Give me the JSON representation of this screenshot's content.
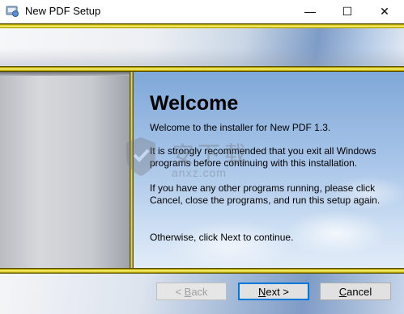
{
  "window": {
    "title": "New PDF Setup",
    "controls": {
      "minimize": "—",
      "maximize": "☐",
      "close": "✕"
    }
  },
  "welcome": {
    "heading": "Welcome",
    "paragraphs": [
      "Welcome to the installer for New PDF 1.3.",
      "It is strongly recommended that you exit all Windows programs before continuing with this installation.",
      "If you have any other programs running, please click Cancel, close the programs, and run this setup again.",
      "Otherwise, click Next to continue."
    ]
  },
  "watermark": {
    "text_cn": "安下载",
    "text_en": "anxz.com"
  },
  "buttons": {
    "back": {
      "mnemonic": "B",
      "rest": "ack",
      "prefix": "< ",
      "state": "disabled"
    },
    "next": {
      "mnemonic": "N",
      "rest": "ext >"
    },
    "cancel": {
      "mnemonic": "C",
      "rest": "ancel"
    }
  },
  "colors": {
    "gold": "#c9b500",
    "focus": "#0078d7"
  }
}
